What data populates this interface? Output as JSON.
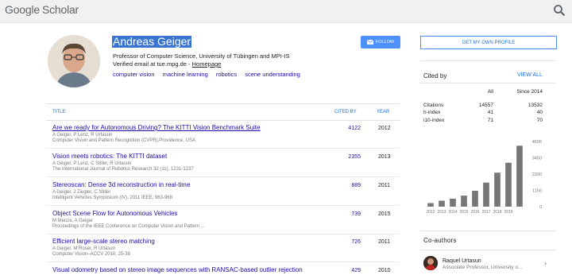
{
  "header": {
    "logo_google": "Google",
    "logo_scholar": "Scholar"
  },
  "profile": {
    "name": "Andreas Geiger",
    "affiliation": "Professor of Computer Science, University of Tübingen and MPI-IS",
    "email_text": "Verified email at tue.mpg.de - ",
    "homepage": "Homepage",
    "interests": [
      "computer vision",
      "machine learning",
      "robotics",
      "scene understanding"
    ],
    "follow_label": "FOLLOW"
  },
  "table": {
    "col_title": "TITLE",
    "col_cited": "CITED BY",
    "col_year": "YEAR",
    "rows": [
      {
        "title": "Are we ready for Autonomous Driving? The KITTI Vision Benchmark Suite",
        "authors": "A Geiger, P Lenz, R Urtasun",
        "venue": "Computer Vision and Pattern Recognition (CVPR),Providence, USA",
        "cited": "4122",
        "year": "2012"
      },
      {
        "title": "Vision meets robotics: The KITTI dataset",
        "authors": "A Geiger, P Lenz, C Stiller, R Urtasun",
        "venue": "The International Journal of Robotics Research 32 (11), 1231-1237",
        "cited": "2355",
        "year": "2013"
      },
      {
        "title": "Stereoscan: Dense 3d reconstruction in real-time",
        "authors": "A Geiger, J Ziegler, C Stiller",
        "venue": "Intelligent Vehicles Symposium (IV), 2011 IEEE, 963-968",
        "cited": "889",
        "year": "2011"
      },
      {
        "title": "Object Scene Flow for Autonomous Vehicles",
        "authors": "M Menze, A Geiger",
        "venue": "Proceedings of the IEEE Conference on Computer Vision and Pattern ...",
        "cited": "739",
        "year": "2015"
      },
      {
        "title": "Efficient large-scale stereo matching",
        "authors": "A Geiger, M Roser, R Urtasun",
        "venue": "Computer Vision–ACCV 2010, 25-38",
        "cited": "726",
        "year": "2011"
      },
      {
        "title": "Visual odometry based on stereo image sequences with RANSAC-based outlier rejection",
        "authors": "",
        "venue": "",
        "cited": "429",
        "year": "2010"
      }
    ]
  },
  "sidebar": {
    "get_profile": "GET MY OWN PROFILE",
    "cited_by": "Cited by",
    "view_all": "VIEW ALL",
    "stats_header": [
      "",
      "All",
      "Since 2014"
    ],
    "stats": [
      {
        "label": "Citations",
        "all": "14557",
        "since": "13532"
      },
      {
        "label": "h-index",
        "all": "41",
        "since": "40"
      },
      {
        "label": "i10-index",
        "all": "71",
        "since": "70"
      }
    ],
    "coauthors_title": "Co-authors",
    "coauthor": {
      "name": "Raquel Urtasun",
      "role": "Associate Professor, University o..."
    }
  },
  "chart_data": {
    "type": "bar",
    "categories": [
      "2012",
      "2013",
      "2014",
      "2015",
      "2016",
      "2017",
      "2018",
      "2019"
    ],
    "values": [
      250,
      420,
      560,
      780,
      1120,
      1700,
      2400,
      3100,
      4300
    ],
    "x_labels": [
      "2012",
      "2013",
      "2014",
      "2015",
      "2016",
      "2017",
      "2018",
      "2019"
    ],
    "ylim": [
      0,
      4600
    ],
    "yticks": [
      "4600",
      "3450",
      "2300",
      "1150",
      "0"
    ],
    "color": "#777777"
  }
}
